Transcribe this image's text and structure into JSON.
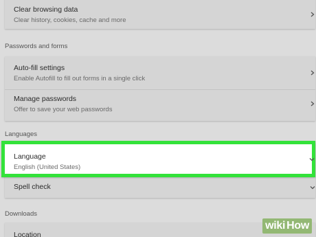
{
  "clear_browsing": {
    "title": "Clear browsing data",
    "subtitle": "Clear history, cookies, cache and more",
    "icon": "chevron-right-icon"
  },
  "passwords_section": {
    "label": "Passwords and forms",
    "items": [
      {
        "title": "Auto-fill settings",
        "subtitle": "Enable Autofill to fill out forms in a single click",
        "icon": "chevron-right-icon"
      },
      {
        "title": "Manage passwords",
        "subtitle": "Offer to save your web passwords",
        "icon": "chevron-right-icon"
      }
    ]
  },
  "languages_section": {
    "label": "Languages",
    "language": {
      "title": "Language",
      "subtitle": "English (United States)",
      "icon": "chevron-down-icon"
    },
    "spell_check": {
      "title": "Spell check",
      "icon": "chevron-down-icon"
    }
  },
  "downloads_section": {
    "label": "Downloads",
    "location": {
      "title": "Location"
    }
  },
  "highlight_color": "#33e23a",
  "watermark": {
    "part1": "wiki",
    "part2": "How"
  }
}
